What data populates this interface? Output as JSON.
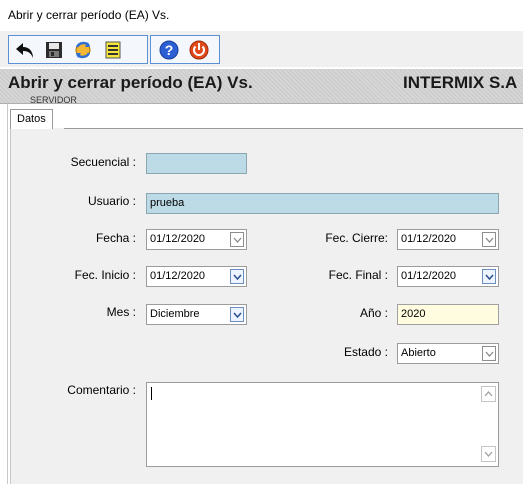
{
  "window": {
    "title": "Abrir y cerrar período (EA) Vs."
  },
  "toolbar": {
    "buttons": [
      {
        "name": "back-icon"
      },
      {
        "name": "save-icon"
      },
      {
        "name": "refresh-icon"
      },
      {
        "name": "report-icon"
      },
      {
        "name": "help-icon"
      },
      {
        "name": "close-icon"
      }
    ]
  },
  "header": {
    "title": "Abrir y cerrar período (EA) Vs.",
    "company": "INTERMIX S.A",
    "subtitle": "SERVIDOR"
  },
  "tabs": [
    {
      "label": "Datos"
    }
  ],
  "form": {
    "secuencial": {
      "label": "Secuencial :",
      "value": ""
    },
    "usuario": {
      "label": "Usuario :",
      "value": "prueba"
    },
    "fecha": {
      "label": "Fecha :",
      "value": "01/12/2020"
    },
    "fec_cierre": {
      "label": "Fec. Cierre:",
      "value": "01/12/2020"
    },
    "fec_inicio": {
      "label": "Fec. Inicio :",
      "value": "01/12/2020"
    },
    "fec_final": {
      "label": "Fec. Final :",
      "value": "01/12/2020"
    },
    "mes": {
      "label": "Mes :",
      "value": "Diciembre"
    },
    "anio": {
      "label": "Año :",
      "value": "2020"
    },
    "estado": {
      "label": "Estado :",
      "value": "Abierto"
    },
    "comentario": {
      "label": "Comentario :",
      "value": ""
    }
  },
  "colors": {
    "header_bg": "#d0d0d0",
    "panel_bg": "#f0f0f0",
    "readonly_blue": "#bcdbe6",
    "editable_yellow": "#fffce0",
    "toolbar_border": "#5b8fd6"
  }
}
